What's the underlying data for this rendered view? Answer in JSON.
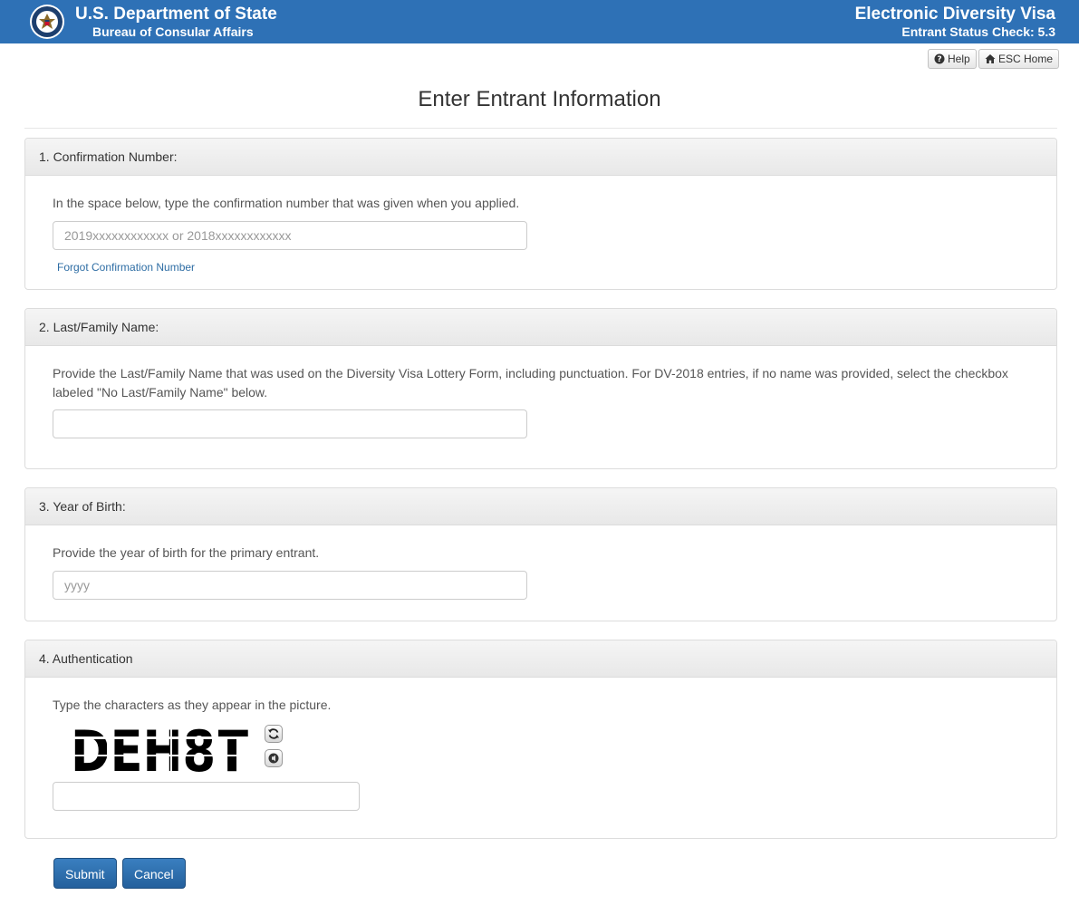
{
  "header": {
    "department": "U.S. Department of State",
    "bureau": "Bureau of Consular Affairs",
    "app_title": "Electronic Diversity Visa",
    "app_subtitle": "Entrant Status Check: 5.3"
  },
  "toolbar": {
    "help_label": "Help",
    "home_label": "ESC Home"
  },
  "page_title": "Enter Entrant Information",
  "sections": {
    "confirmation": {
      "heading": "1. Confirmation Number:",
      "instruction": "In the space below, type the confirmation number that was given when you applied.",
      "placeholder": "2019xxxxxxxxxxxx or 2018xxxxxxxxxxxx",
      "value": "",
      "link_label": "Forgot Confirmation Number"
    },
    "last_name": {
      "heading": "2. Last/Family Name:",
      "instruction": "Provide the Last/Family Name that was used on the Diversity Visa Lottery Form, including punctuation. For DV-2018 entries, if no name was provided, select the checkbox labeled \"No Last/Family Name\" below.",
      "placeholder": "",
      "value": ""
    },
    "birth_year": {
      "heading": "3. Year of Birth:",
      "instruction": "Provide the year of birth for the primary entrant.",
      "placeholder": "yyyy",
      "value": ""
    },
    "authentication": {
      "heading": "4. Authentication",
      "instruction": "Type the characters as they appear in the picture.",
      "captcha_text": "DEH8T",
      "placeholder": "",
      "value": ""
    }
  },
  "actions": {
    "submit_label": "Submit",
    "cancel_label": "Cancel"
  },
  "colors": {
    "header_blue": "#2e71b6",
    "button_blue": "#2c6aa8",
    "link_blue": "#2e6da4"
  },
  "icons": {
    "seal": "state-department-seal-icon",
    "help": "question-circle-icon",
    "home": "home-icon",
    "refresh": "refresh-icon",
    "audio": "audio-icon"
  }
}
